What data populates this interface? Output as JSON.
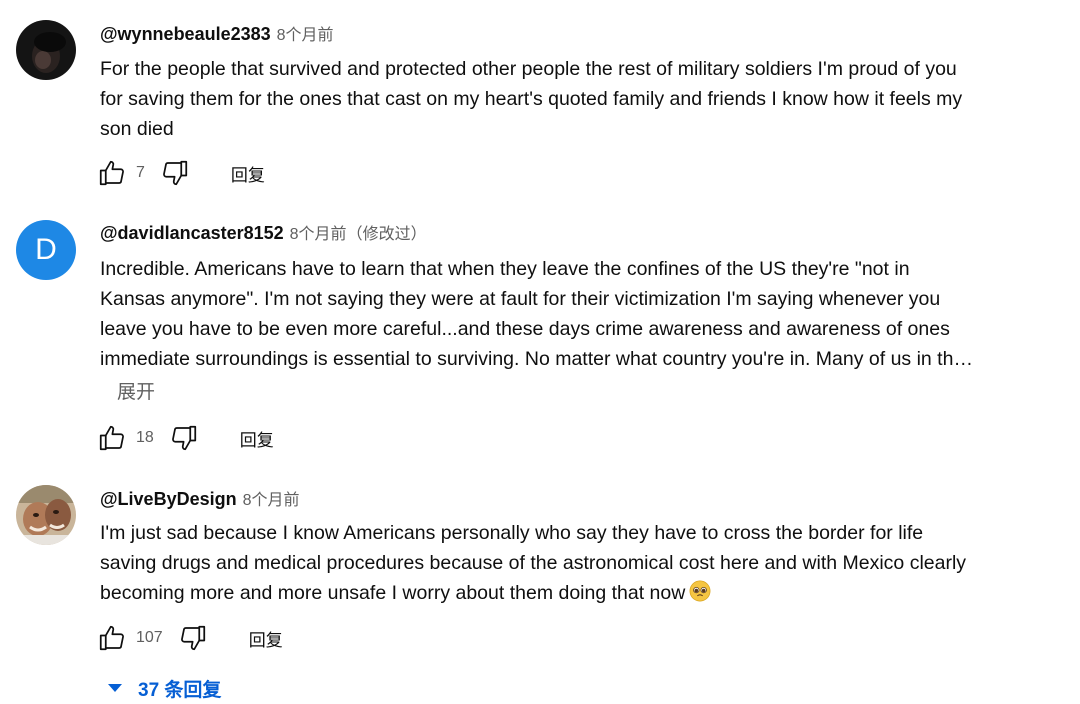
{
  "comments": [
    {
      "author": "@wynnebeaule2383",
      "time": "8个月前",
      "edited": "",
      "lines": [
        "For the people that survived and protected other people the rest of military soldiers I'm proud of you",
        "for saving them for the ones that cast on my heart's quoted family and friends I know how it feels my",
        "son died"
      ],
      "likes": "7",
      "reply_label": "回复"
    },
    {
      "author": "@davidlancaster8152",
      "time": "8个月前",
      "edited": "（修改过）",
      "avatar_letter": "D",
      "lines": [
        "Incredible. Americans have to learn that when they leave the confines of the US they're \"not in",
        "Kansas anymore\". I'm not saying they were at fault for their victimization I'm saying whenever you",
        "leave you have to be even more careful...and these days crime awareness and awareness of ones",
        "immediate surroundings is essential to surviving. No matter what country you're in. Many of us in th…"
      ],
      "read_more": "展开",
      "likes": "18",
      "reply_label": "回复"
    },
    {
      "author": "@LiveByDesign",
      "time": "8个月前",
      "edited": "",
      "lines": [
        "I'm just sad because I know Americans personally who say they have to cross the border for life",
        "saving drugs and medical procedures because of the astronomical cost here and with Mexico clearly",
        "becoming more and more unsafe I worry about them doing that now"
      ],
      "emoji_icon": "pleading-face-emoji",
      "likes": "107",
      "reply_label": "回复",
      "replies_toggle": "37 条回复"
    }
  ],
  "colors": {
    "accent_blue": "#065fd4",
    "avatar_d_bg": "#1e88e5",
    "meta_gray": "#606060"
  }
}
